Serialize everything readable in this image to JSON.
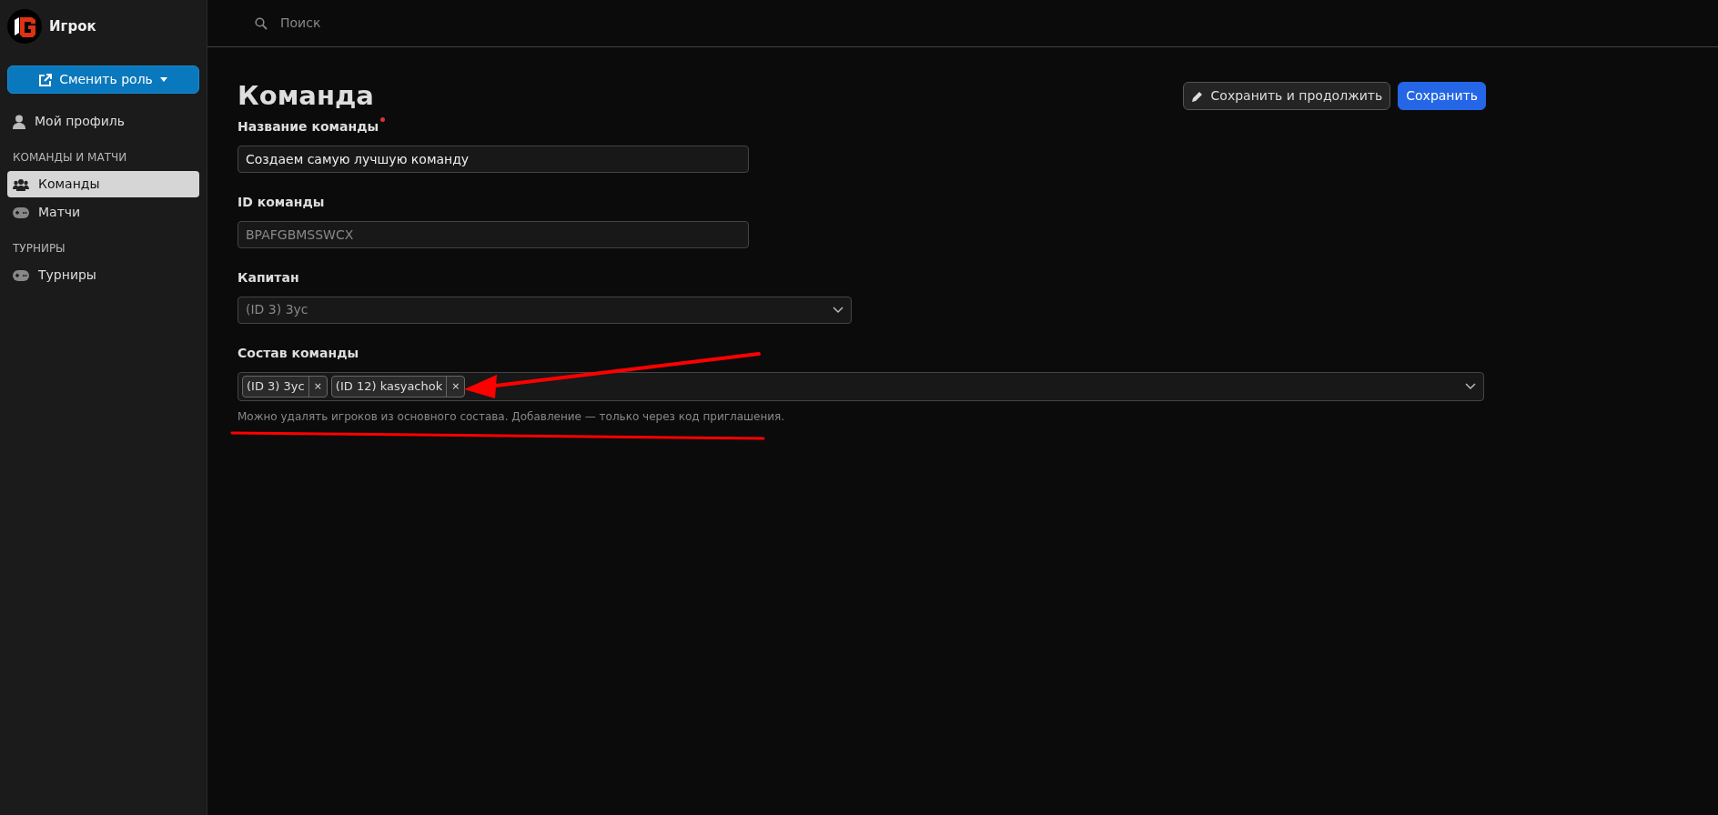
{
  "sidebar": {
    "brand": "Игрок",
    "role_button": "Сменить роль",
    "items": [
      {
        "kind": "link",
        "label": "Мой профиль",
        "selected": false
      },
      {
        "kind": "heading",
        "label": "КОМАНДЫ И МАТЧИ"
      },
      {
        "kind": "link",
        "label": "Команды",
        "selected": true
      },
      {
        "kind": "link",
        "label": "Матчи",
        "selected": false
      },
      {
        "kind": "heading",
        "label": "ТУРНИРЫ"
      },
      {
        "kind": "link",
        "label": "Турниры",
        "selected": false
      }
    ]
  },
  "search": {
    "placeholder": "Поиск"
  },
  "page": {
    "title": "Команда",
    "buttons": [
      {
        "kind": "secondary",
        "label": "Сохранить и продолжить"
      },
      {
        "kind": "primary",
        "label": "Сохранить"
      }
    ]
  },
  "fields": [
    {
      "kind": "text",
      "label": "Название команды",
      "required": true,
      "value": "Создаем самую лучшую команду",
      "disabled": false
    },
    {
      "kind": "text",
      "label": "ID команды",
      "required": false,
      "value": "BPAFGBMSSWCX",
      "disabled": true
    },
    {
      "kind": "select",
      "label": "Капитан",
      "required": false,
      "value": "(ID 3) 3ус",
      "disabled": true
    },
    {
      "kind": "tags",
      "label": "Состав команды",
      "required": false,
      "tags": [
        "(ID 3) 3ус",
        "(ID 12) kasyachok"
      ],
      "remove": "×",
      "help": "Можно удалять игроков из основного состава. Добавление — только через код приглашения."
    }
  ],
  "annotations": {
    "arrow": true,
    "underline": true
  }
}
